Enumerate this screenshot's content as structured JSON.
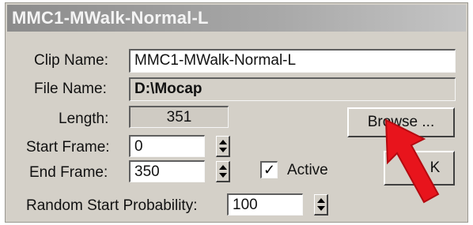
{
  "window": {
    "title": "MMC1-MWalk-Normal-L"
  },
  "clip_name": {
    "label": "Clip Name:",
    "value": "MMC1-MWalk-Normal-L"
  },
  "file_name": {
    "label": "File Name:",
    "value": "D:\\Mocap"
  },
  "length": {
    "label": "Length:",
    "value": "351"
  },
  "browse": {
    "label": "Browse ..."
  },
  "start_frame": {
    "label": "Start Frame:",
    "value": "0"
  },
  "end_frame": {
    "label": "End Frame:",
    "value": "350"
  },
  "active": {
    "label": "Active",
    "checked": true,
    "mark": "✓"
  },
  "ok": {
    "label": "OK",
    "visible_text": "K"
  },
  "random_start": {
    "label": "Random Start Probability:",
    "value": "100"
  },
  "colors": {
    "annotation_arrow": "#e8141c",
    "dialog_bg": "#d4d0c8"
  },
  "annotation": {
    "icon": "red-arrow-pointing-to-browse"
  }
}
